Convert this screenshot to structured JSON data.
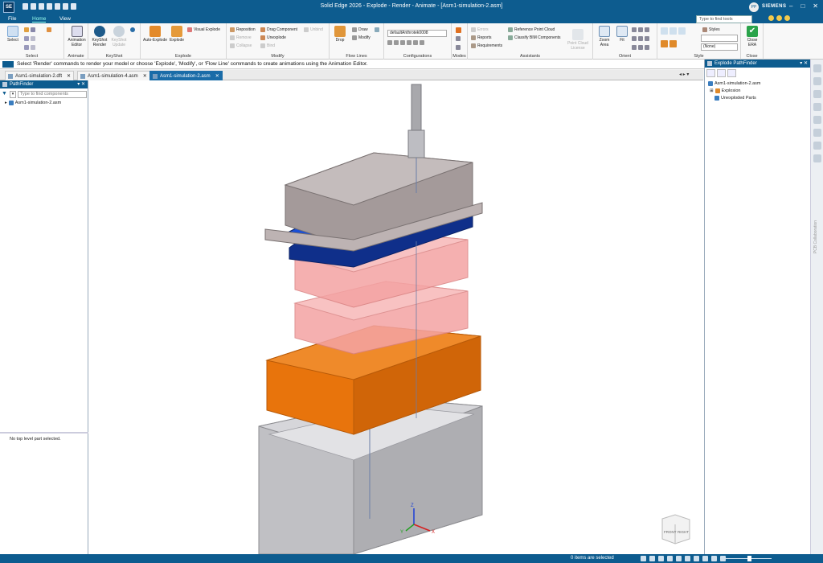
{
  "app": {
    "logo": "SE",
    "title": "Solid Edge 2026 - Explode - Render - Animate - [Asm1-simulation-2.asm]",
    "search_placeholder": "Type to find tools",
    "user_initials": "PP",
    "brand": "SIEMENS",
    "window_controls": [
      "–",
      "□",
      "✕"
    ]
  },
  "menu": {
    "tabs": [
      "File",
      "Home",
      "View"
    ],
    "active": "Home"
  },
  "ribbon": {
    "select": {
      "label": "Select",
      "group": "Select"
    },
    "animate": {
      "editor": "Animation Editor",
      "group": "Animate"
    },
    "keyshot": {
      "render": "KeyShot Render",
      "update": "KeyShot Update",
      "group": "KeyShot"
    },
    "explode": {
      "auto": "Auto-Explode",
      "explode": "Explode",
      "visual": "Visual Explode",
      "group": "Explode"
    },
    "modify": {
      "items": [
        "Reposition",
        "Remove",
        "Collapse",
        "Drag Component",
        "Unexplode",
        "Bind",
        "Unbind"
      ],
      "group": "Modify"
    },
    "flowlines": {
      "drop": "Drop",
      "draw": "Draw",
      "modify": "Modify",
      "group": "Flow Lines"
    },
    "configurations": {
      "value": "defaultAnthrotek0008",
      "group": "Configurations"
    },
    "modes": {
      "group": "Modes"
    },
    "assistants": {
      "items": [
        "Errors",
        "Reports",
        "Requirements",
        "Reference Point Cloud",
        "Classify BIM Components",
        "Point Cloud License"
      ],
      "group": "Assistants"
    },
    "orient": {
      "zoom": "Zoom Area",
      "fit": "Fit",
      "group": "Orient"
    },
    "style": {
      "styles": "Styles",
      "none": "(None)",
      "group": "Style"
    },
    "close": {
      "label": "Close ERA",
      "group": "Close"
    }
  },
  "prompt": "Select 'Render' commands to render your model or choose 'Explode', 'Modify', or 'Flow Line' commands to create animations using the Animation Editor.",
  "doc_tabs": [
    "Asm1-simulation-2.dft",
    "Asm1-simulation-4.asm",
    "Asm1-simulation-2.asm"
  ],
  "doc_tab_active": 2,
  "pathfinder": {
    "title": "PathFinder",
    "find_placeholder": "Type to find components",
    "root": "Asm1-simulation-2.asm",
    "status": "No top level part selected."
  },
  "explode_pathfinder": {
    "title": "Explode PathFinder",
    "root": "Asm1-simulation-2.asm",
    "items": [
      "Explosion",
      "Unexploded Parts"
    ]
  },
  "viewcube": {
    "front": "FRONT",
    "right": "RIGHT"
  },
  "triad": {
    "x": "X",
    "y": "Y",
    "z": "Z"
  },
  "statusbar": {
    "message": "0 items are selected"
  },
  "colors": {
    "brand_blue": "#0d5c8f",
    "part_blue": "#1a4fd6",
    "part_pink": "#f2a6a6",
    "part_orange": "#e8740c",
    "part_gray": "#b9b9bd",
    "cover_gray": "#b7aeae"
  },
  "sidebar_label": "PCB Collaboration"
}
